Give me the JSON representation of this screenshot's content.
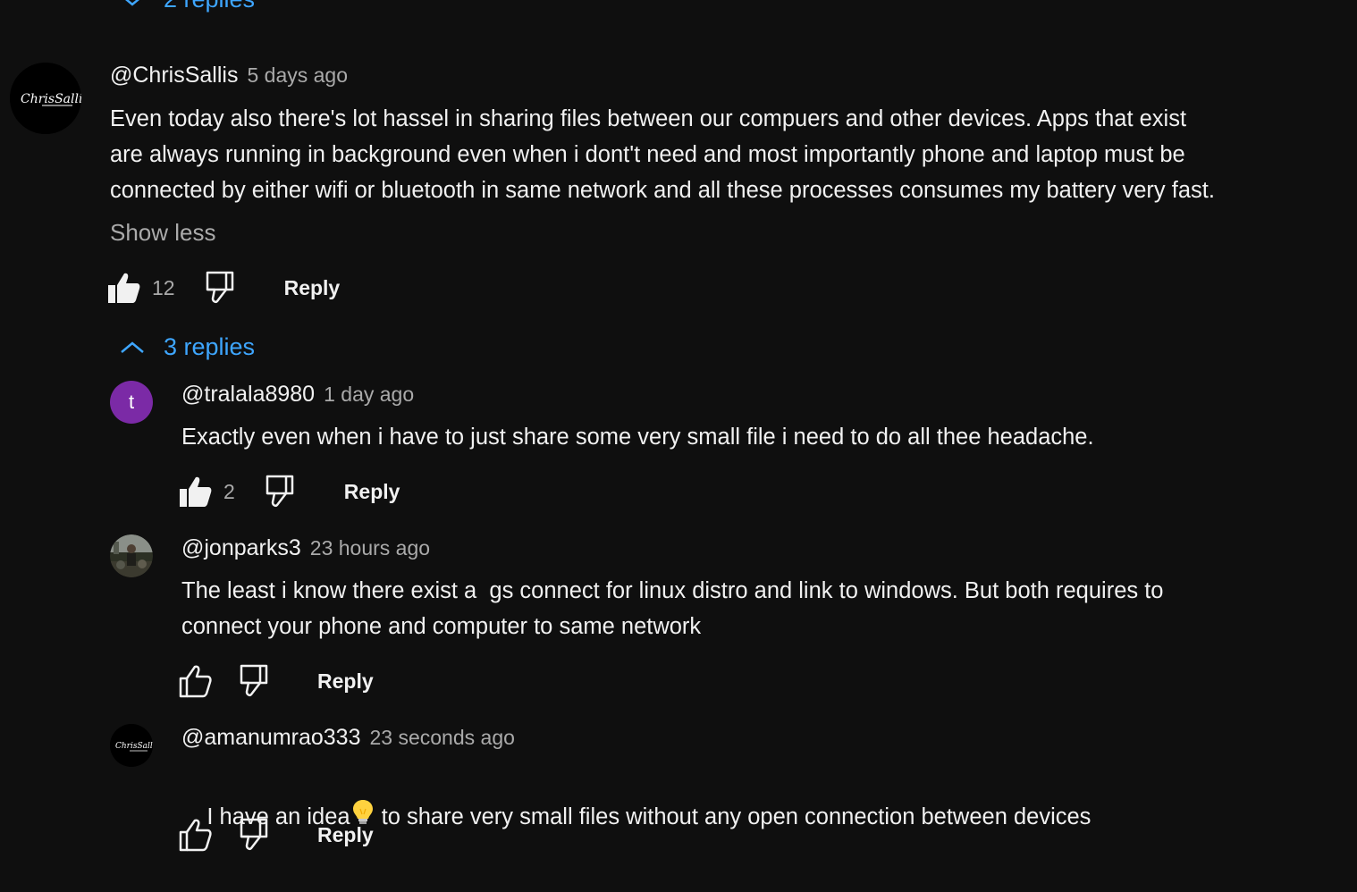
{
  "top_replies_toggle": {
    "label": "2 replies"
  },
  "main_comment": {
    "author": "@ChrisSallis",
    "time": "5 days ago",
    "lines": [
      "Even today also there's lot hassel in sharing files between our compuers and other devices. Apps that exist",
      "are always running in background even when i dont't need and most importantly phone and laptop must be",
      "connected by either wifi or bluetooth in same network and all these processes consumes my battery very fast."
    ],
    "show_less": "Show less",
    "likes": "12",
    "reply_label": "Reply",
    "avatar_text": "ChrisSallis"
  },
  "replies_toggle": {
    "label": "3 replies"
  },
  "replies": [
    {
      "author": "@tralala8980",
      "time": "1 day ago",
      "avatar_letter": "t",
      "lines": [
        "Exactly even when i have to just share some very small file i need to do all thee headache."
      ],
      "likes": "2",
      "reply_label": "Reply"
    },
    {
      "author": "@jonparks3",
      "time": "23 hours ago",
      "lines": [
        "The least i know there exist a  gs connect for linux distro and link to windows. But both requires to",
        "connect your phone and computer to same network"
      ],
      "reply_label": "Reply"
    },
    {
      "author": "@amanumrao333",
      "time": "23 seconds ago",
      "text_before": "I have an idea",
      "text_after": " to share very small files without any open connection between devices",
      "reply_label": "Reply"
    }
  ],
  "colors": {
    "link": "#3ea6ff",
    "muted": "#aaaaaa",
    "text": "#f1f1f1",
    "bg": "#0f0f0f",
    "avatar_t": "#7b2aa6"
  },
  "icons": [
    "chevron-down-icon",
    "chevron-up-icon",
    "thumb-up-icon",
    "thumb-down-icon",
    "lightbulb-icon"
  ]
}
